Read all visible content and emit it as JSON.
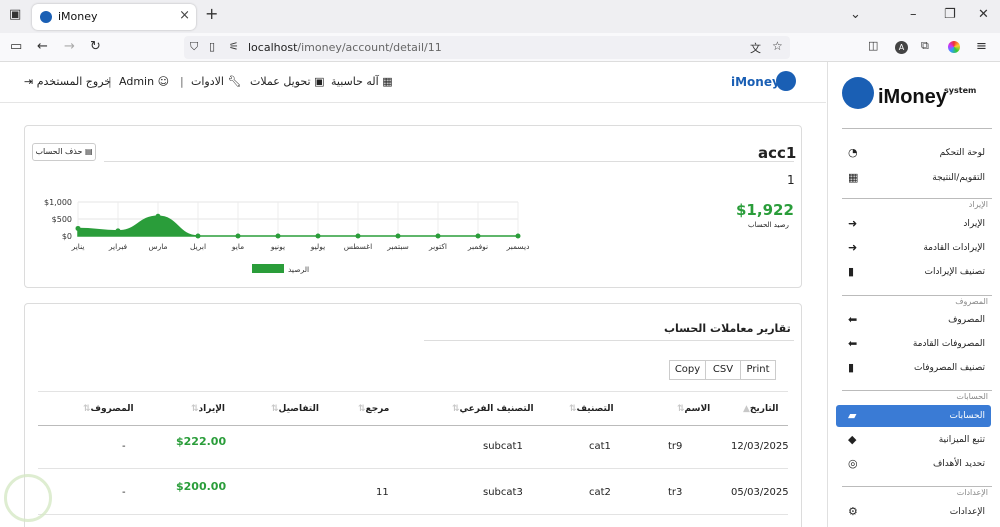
{
  "browser": {
    "tab_title": "iMoney",
    "url_host": "localhost",
    "url_path": "/imoney/account/detail/11",
    "new_tab": "+",
    "tab_close": "×"
  },
  "sidebar": {
    "logo_text": "iMoney",
    "logo_sup": "system",
    "items": [
      {
        "label": "لوحة التحكم",
        "icon": "dashboard-icon"
      },
      {
        "label": "التقويم/النتيجة",
        "icon": "calendar-icon"
      },
      {
        "section": "الإيراد"
      },
      {
        "label": "الإيراد",
        "icon": "arrow-right-icon"
      },
      {
        "label": "الإيرادات القادمة",
        "icon": "arrow-right-icon"
      },
      {
        "label": "تصنيف الإيرادات",
        "icon": "bookmark-icon"
      },
      {
        "section": "المصروف"
      },
      {
        "label": "المصروف",
        "icon": "arrow-left-icon"
      },
      {
        "label": "المصروفات القادمة",
        "icon": "arrow-left-icon"
      },
      {
        "label": "تصنيف المصروفات",
        "icon": "bookmark-icon"
      },
      {
        "section": "الحسابات"
      },
      {
        "label": "الحسابات",
        "icon": "folder-open-icon",
        "active": true
      },
      {
        "label": "تتبع الميزانية",
        "icon": "tags-icon"
      },
      {
        "label": "تحديد الأهداف",
        "icon": "life-ring-icon"
      },
      {
        "section": "الإعدادات"
      },
      {
        "label": "الإعدادات",
        "icon": "gear-icon"
      }
    ]
  },
  "topnav": {
    "brand": "iMoney",
    "calculator": "آله حاسبية",
    "currency": "تحويل عملات",
    "tools": "الادوات",
    "user": "Admin",
    "logout": "خروج المستخدم",
    "sep": "|"
  },
  "account": {
    "title": "acc1",
    "number": "1",
    "delete_label": "حذف الحساب",
    "balance": "$1,922",
    "balance_label": "رصيد الحساب"
  },
  "chart_data": {
    "type": "area",
    "categories": [
      "يناير",
      "فبراير",
      "مارس",
      "ابريل",
      "مايو",
      "يونيو",
      "يوليو",
      "اغسطس",
      "سبتمبر",
      "اكتوبر",
      "نوفمبر",
      "ديسمبر"
    ],
    "series": [
      {
        "name": "الرصيد",
        "values": [
          222,
          150,
          580,
          0,
          0,
          0,
          0,
          0,
          0,
          0,
          0,
          0
        ]
      }
    ],
    "yticks": [
      "$0",
      "$500",
      "$1,000"
    ],
    "ylim": [
      0,
      1000
    ],
    "color": "#2a9d3a",
    "legend_position": "bottom"
  },
  "report": {
    "title": "تقارير معاملات الحساب",
    "buttons": [
      "Copy",
      "CSV",
      "Print"
    ],
    "headers": [
      "التاريخ",
      "الاسم",
      "التصنيف",
      "التصنيف الفرعي",
      "مرجع",
      "التفاصيل",
      "الإيراد",
      "المصروف"
    ],
    "rows": [
      {
        "date": "12/03/2025",
        "name": "tr9",
        "cat": "cat1",
        "subcat": "subcat1",
        "ref": "",
        "details": "",
        "income": "$222.00",
        "expense": "-"
      },
      {
        "date": "05/03/2025",
        "name": "tr3",
        "cat": "cat2",
        "subcat": "subcat3",
        "ref": "11",
        "details": "",
        "income": "$200.00",
        "expense": "-"
      }
    ]
  }
}
